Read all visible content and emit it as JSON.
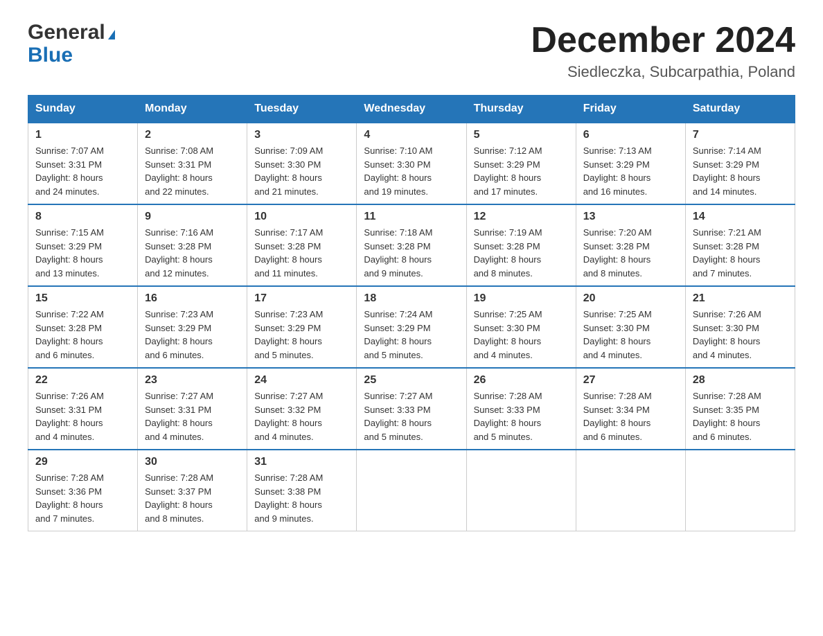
{
  "header": {
    "logo_general": "General",
    "logo_blue": "Blue",
    "title": "December 2024",
    "location": "Siedleczka, Subcarpathia, Poland"
  },
  "days_of_week": [
    "Sunday",
    "Monday",
    "Tuesday",
    "Wednesday",
    "Thursday",
    "Friday",
    "Saturday"
  ],
  "weeks": [
    [
      {
        "num": "1",
        "sunrise": "7:07 AM",
        "sunset": "3:31 PM",
        "daylight": "8 hours and 24 minutes."
      },
      {
        "num": "2",
        "sunrise": "7:08 AM",
        "sunset": "3:31 PM",
        "daylight": "8 hours and 22 minutes."
      },
      {
        "num": "3",
        "sunrise": "7:09 AM",
        "sunset": "3:30 PM",
        "daylight": "8 hours and 21 minutes."
      },
      {
        "num": "4",
        "sunrise": "7:10 AM",
        "sunset": "3:30 PM",
        "daylight": "8 hours and 19 minutes."
      },
      {
        "num": "5",
        "sunrise": "7:12 AM",
        "sunset": "3:29 PM",
        "daylight": "8 hours and 17 minutes."
      },
      {
        "num": "6",
        "sunrise": "7:13 AM",
        "sunset": "3:29 PM",
        "daylight": "8 hours and 16 minutes."
      },
      {
        "num": "7",
        "sunrise": "7:14 AM",
        "sunset": "3:29 PM",
        "daylight": "8 hours and 14 minutes."
      }
    ],
    [
      {
        "num": "8",
        "sunrise": "7:15 AM",
        "sunset": "3:29 PM",
        "daylight": "8 hours and 13 minutes."
      },
      {
        "num": "9",
        "sunrise": "7:16 AM",
        "sunset": "3:28 PM",
        "daylight": "8 hours and 12 minutes."
      },
      {
        "num": "10",
        "sunrise": "7:17 AM",
        "sunset": "3:28 PM",
        "daylight": "8 hours and 11 minutes."
      },
      {
        "num": "11",
        "sunrise": "7:18 AM",
        "sunset": "3:28 PM",
        "daylight": "8 hours and 9 minutes."
      },
      {
        "num": "12",
        "sunrise": "7:19 AM",
        "sunset": "3:28 PM",
        "daylight": "8 hours and 8 minutes."
      },
      {
        "num": "13",
        "sunrise": "7:20 AM",
        "sunset": "3:28 PM",
        "daylight": "8 hours and 8 minutes."
      },
      {
        "num": "14",
        "sunrise": "7:21 AM",
        "sunset": "3:28 PM",
        "daylight": "8 hours and 7 minutes."
      }
    ],
    [
      {
        "num": "15",
        "sunrise": "7:22 AM",
        "sunset": "3:28 PM",
        "daylight": "8 hours and 6 minutes."
      },
      {
        "num": "16",
        "sunrise": "7:23 AM",
        "sunset": "3:29 PM",
        "daylight": "8 hours and 6 minutes."
      },
      {
        "num": "17",
        "sunrise": "7:23 AM",
        "sunset": "3:29 PM",
        "daylight": "8 hours and 5 minutes."
      },
      {
        "num": "18",
        "sunrise": "7:24 AM",
        "sunset": "3:29 PM",
        "daylight": "8 hours and 5 minutes."
      },
      {
        "num": "19",
        "sunrise": "7:25 AM",
        "sunset": "3:30 PM",
        "daylight": "8 hours and 4 minutes."
      },
      {
        "num": "20",
        "sunrise": "7:25 AM",
        "sunset": "3:30 PM",
        "daylight": "8 hours and 4 minutes."
      },
      {
        "num": "21",
        "sunrise": "7:26 AM",
        "sunset": "3:30 PM",
        "daylight": "8 hours and 4 minutes."
      }
    ],
    [
      {
        "num": "22",
        "sunrise": "7:26 AM",
        "sunset": "3:31 PM",
        "daylight": "8 hours and 4 minutes."
      },
      {
        "num": "23",
        "sunrise": "7:27 AM",
        "sunset": "3:31 PM",
        "daylight": "8 hours and 4 minutes."
      },
      {
        "num": "24",
        "sunrise": "7:27 AM",
        "sunset": "3:32 PM",
        "daylight": "8 hours and 4 minutes."
      },
      {
        "num": "25",
        "sunrise": "7:27 AM",
        "sunset": "3:33 PM",
        "daylight": "8 hours and 5 minutes."
      },
      {
        "num": "26",
        "sunrise": "7:28 AM",
        "sunset": "3:33 PM",
        "daylight": "8 hours and 5 minutes."
      },
      {
        "num": "27",
        "sunrise": "7:28 AM",
        "sunset": "3:34 PM",
        "daylight": "8 hours and 6 minutes."
      },
      {
        "num": "28",
        "sunrise": "7:28 AM",
        "sunset": "3:35 PM",
        "daylight": "8 hours and 6 minutes."
      }
    ],
    [
      {
        "num": "29",
        "sunrise": "7:28 AM",
        "sunset": "3:36 PM",
        "daylight": "8 hours and 7 minutes."
      },
      {
        "num": "30",
        "sunrise": "7:28 AM",
        "sunset": "3:37 PM",
        "daylight": "8 hours and 8 minutes."
      },
      {
        "num": "31",
        "sunrise": "7:28 AM",
        "sunset": "3:38 PM",
        "daylight": "8 hours and 9 minutes."
      },
      null,
      null,
      null,
      null
    ]
  ],
  "labels": {
    "sunrise": "Sunrise:",
    "sunset": "Sunset:",
    "daylight": "Daylight:"
  }
}
